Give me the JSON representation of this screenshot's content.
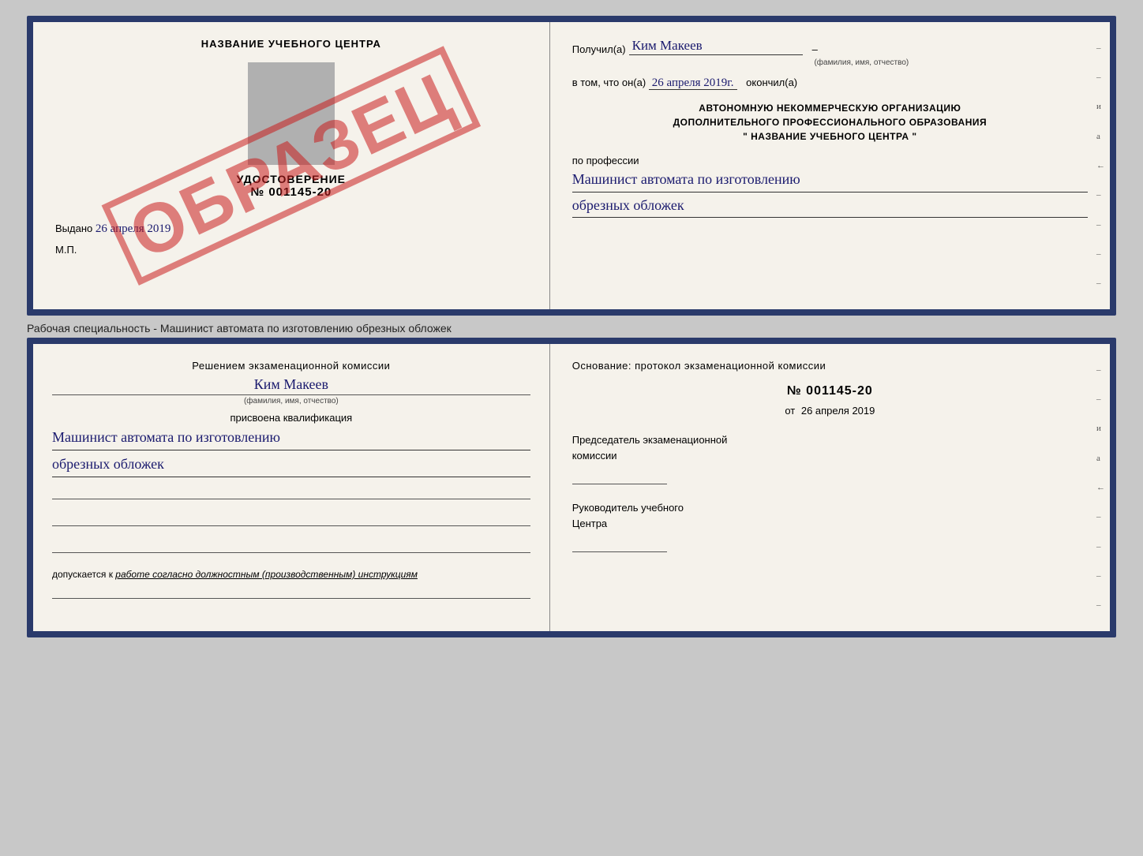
{
  "topDoc": {
    "left": {
      "title": "НАЗВАНИЕ УЧЕБНОГО ЦЕНТРА",
      "stamp": "ОБРАЗЕЦ",
      "certLabel": "УДОСТОВЕРЕНИЕ",
      "certNumber": "№ 001145-20",
      "issuedLine": "Выдано",
      "issuedDate": "26 апреля 2019",
      "mpLabel": "М.П."
    },
    "right": {
      "receivedPrefix": "Получил(а)",
      "receivedName": "Ким Макеев",
      "fioHint": "(фамилия, имя, отчество)",
      "vtomPrefix": "в том, что он(а)",
      "date": "26 апреля 2019г.",
      "okончilSuffix": "окончил(а)",
      "orgLine1": "АВТОНОМНУЮ НЕКОММЕРЧЕСКУЮ ОРГАНИЗАЦИЮ",
      "orgLine2": "ДОПОЛНИТЕЛЬНОГО ПРОФЕССИОНАЛЬНОГО ОБРАЗОВАНИЯ",
      "orgLine3": "\"  НАЗВАНИЕ УЧЕБНОГО ЦЕНТРА  \"",
      "poProfessii": "по профессии",
      "profession1": "Машинист автомата по изготовлению",
      "profession2": "обрезных обложек"
    }
  },
  "betweenText": "Рабочая специальность - Машинист автомата по изготовлению обрезных обложек",
  "bottomDoc": {
    "left": {
      "resheniyemTitle": "Решением экзаменационной комиссии",
      "personName": "Ким Макеев",
      "fioHint": "(фамилия, имя, отчество)",
      "prisvoenaLabel": "присвоена квалификация",
      "qual1": "Машинист автомата по изготовлению",
      "qual2": "обрезных обложек",
      "dopuskaetsyaPrefix": "допускается к",
      "dopuskaetsyaItalic": "работе согласно должностным (производственным) инструкциям"
    },
    "right": {
      "osnovanieTitleLine1": "Основание: протокол экзаменационной комиссии",
      "protocolNumber": "№  001145-20",
      "protocolDatePrefix": "от",
      "protocolDate": "26 апреля 2019",
      "predsedatelLabel": "Председатель экзаменационной",
      "predsedatelLabel2": "комиссии",
      "rukovoditelLabel": "Руководитель учебного",
      "rukovoditelLabel2": "Центра"
    }
  },
  "sideDashes": [
    "-",
    "-",
    "-",
    "и",
    "а",
    "←",
    "-",
    "-",
    "-",
    "-"
  ]
}
